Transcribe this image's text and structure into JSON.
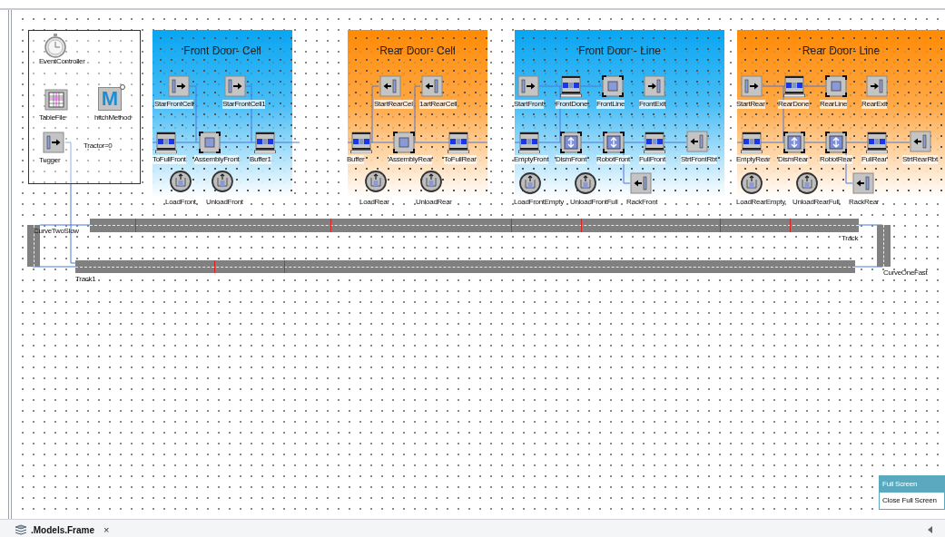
{
  "toolbox": {
    "items": [
      {
        "kind": "event",
        "label": "EventController"
      },
      {
        "kind": "table",
        "label": "TableFile"
      },
      {
        "kind": "method",
        "label": "hitchMethod",
        "glyph": "M"
      },
      {
        "kind": "source",
        "label": "Tugger"
      },
      {
        "kind": "text",
        "label": "Tractor=0"
      }
    ]
  },
  "panels": [
    {
      "title": "Front Door- Cell",
      "color": "#09a6f2",
      "nodes": [
        {
          "kind": "source",
          "label": "StarFrontCell"
        },
        {
          "kind": "source",
          "label": "StarFrontCell1"
        },
        {
          "kind": "buffer",
          "label": "ToFullFront"
        },
        {
          "kind": "station",
          "label": "AssemblyFront"
        },
        {
          "kind": "buffer",
          "label": "Buffer1"
        },
        {
          "kind": "worker",
          "label": "LoadFront"
        },
        {
          "kind": "worker",
          "label": "UnloadFront"
        }
      ]
    },
    {
      "title": "Rear Door- Cell",
      "color": "#ff8a05",
      "nodes": [
        {
          "kind": "reverse",
          "label": "StartRearCel"
        },
        {
          "kind": "reverse",
          "label": "1artRearCell"
        },
        {
          "kind": "buffer",
          "label": "Buffer"
        },
        {
          "kind": "station",
          "label": "AssemblyRear"
        },
        {
          "kind": "buffer",
          "label": "ToFullRear"
        },
        {
          "kind": "worker",
          "label": "LoadRear"
        },
        {
          "kind": "worker",
          "label": "UnloadRear"
        }
      ]
    },
    {
      "title": "Front Door - Line",
      "color": "#09a6f2",
      "nodes": [
        {
          "kind": "source",
          "label": "StartFront"
        },
        {
          "kind": "buffer",
          "label": "FrontDone"
        },
        {
          "kind": "station",
          "label": "FrontLine"
        },
        {
          "kind": "drain",
          "label": "FrontExit"
        },
        {
          "kind": "buffer",
          "label": "EmptyFront"
        },
        {
          "kind": "robot",
          "label": "DismFront"
        },
        {
          "kind": "robot",
          "label": "RobotFront"
        },
        {
          "kind": "buffer",
          "label": "FullFront"
        },
        {
          "kind": "reverse",
          "label": "StrtFrontRbt"
        },
        {
          "kind": "worker",
          "label": "LoadFrontEmpty"
        },
        {
          "kind": "worker",
          "label": "UnloadFrontFull"
        },
        {
          "kind": "reverse",
          "label": "RackFront"
        }
      ]
    },
    {
      "title": "Rear Door- Line",
      "color": "#ff8a05",
      "nodes": [
        {
          "kind": "source",
          "label": "StartRear"
        },
        {
          "kind": "buffer",
          "label": "RearDone"
        },
        {
          "kind": "station",
          "label": "RearLine"
        },
        {
          "kind": "drain",
          "label": "RearExit"
        },
        {
          "kind": "buffer",
          "label": "EmptyRear"
        },
        {
          "kind": "robot",
          "label": "DismRear"
        },
        {
          "kind": "robot",
          "label": "RobotRear"
        },
        {
          "kind": "buffer",
          "label": "FullRear"
        },
        {
          "kind": "reverse",
          "label": "StrtRearRbt"
        },
        {
          "kind": "worker",
          "label": "LoadRearEmpty"
        },
        {
          "kind": "worker",
          "label": "UnloadRearFull"
        },
        {
          "kind": "reverse",
          "label": "RackRear"
        }
      ]
    }
  ],
  "tracks": [
    {
      "kind": "straight",
      "label": "Track"
    },
    {
      "kind": "straight",
      "label": "Track1"
    },
    {
      "kind": "curve",
      "label": "CurveTwoSlow"
    },
    {
      "kind": "curve",
      "label": "CurveOneFast"
    }
  ],
  "context_menu": [
    {
      "label": "Full Screen",
      "selected": true
    },
    {
      "label": "Close Full Screen",
      "selected": false
    }
  ],
  "tab": {
    "label": ".Models.Frame",
    "close": "×"
  }
}
